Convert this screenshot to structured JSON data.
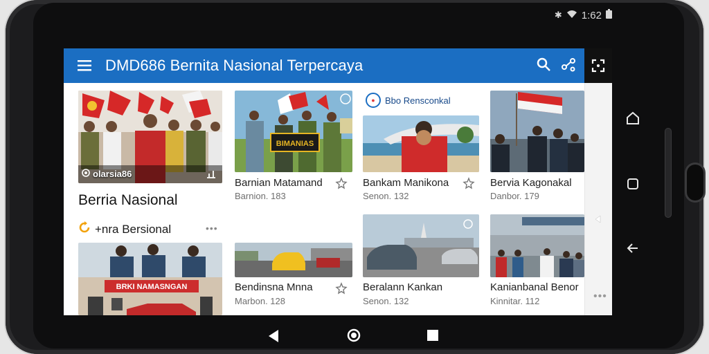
{
  "status_bar": {
    "time": "1:62"
  },
  "app_bar": {
    "title": "DMD686 Bernita Nasional Terpercaya"
  },
  "featured": {
    "overlay_label": "olarsia86"
  },
  "section": {
    "heading": "Berria Nasional",
    "sub_heading": "+nra Bersional"
  },
  "cards": [
    {
      "title": "Barnian Matamand",
      "meta": "Barnion. 183"
    },
    {
      "title": "Bankam Manikona",
      "meta": "Senon. 132"
    },
    {
      "title": "Bervia Kagonakal",
      "meta": "Danbor. 179"
    },
    {
      "title": "Bendinsna Mnna",
      "meta": "Marbon. 128"
    },
    {
      "title": "Beralann Kankan",
      "meta": "Senon. 132"
    },
    {
      "title": "Kanianbanal Benor",
      "meta": "Kinnitar. 112"
    }
  ],
  "brand": {
    "name": "Bbo Rensconkal"
  },
  "banners": {
    "hero_sign": "BIMANIAS",
    "lower_sign": "BRKI NAMASNGAN"
  },
  "colors": {
    "app_bar": "#1b6ec2",
    "device": "#1c1c1e",
    "flag_red": "#d62828"
  }
}
